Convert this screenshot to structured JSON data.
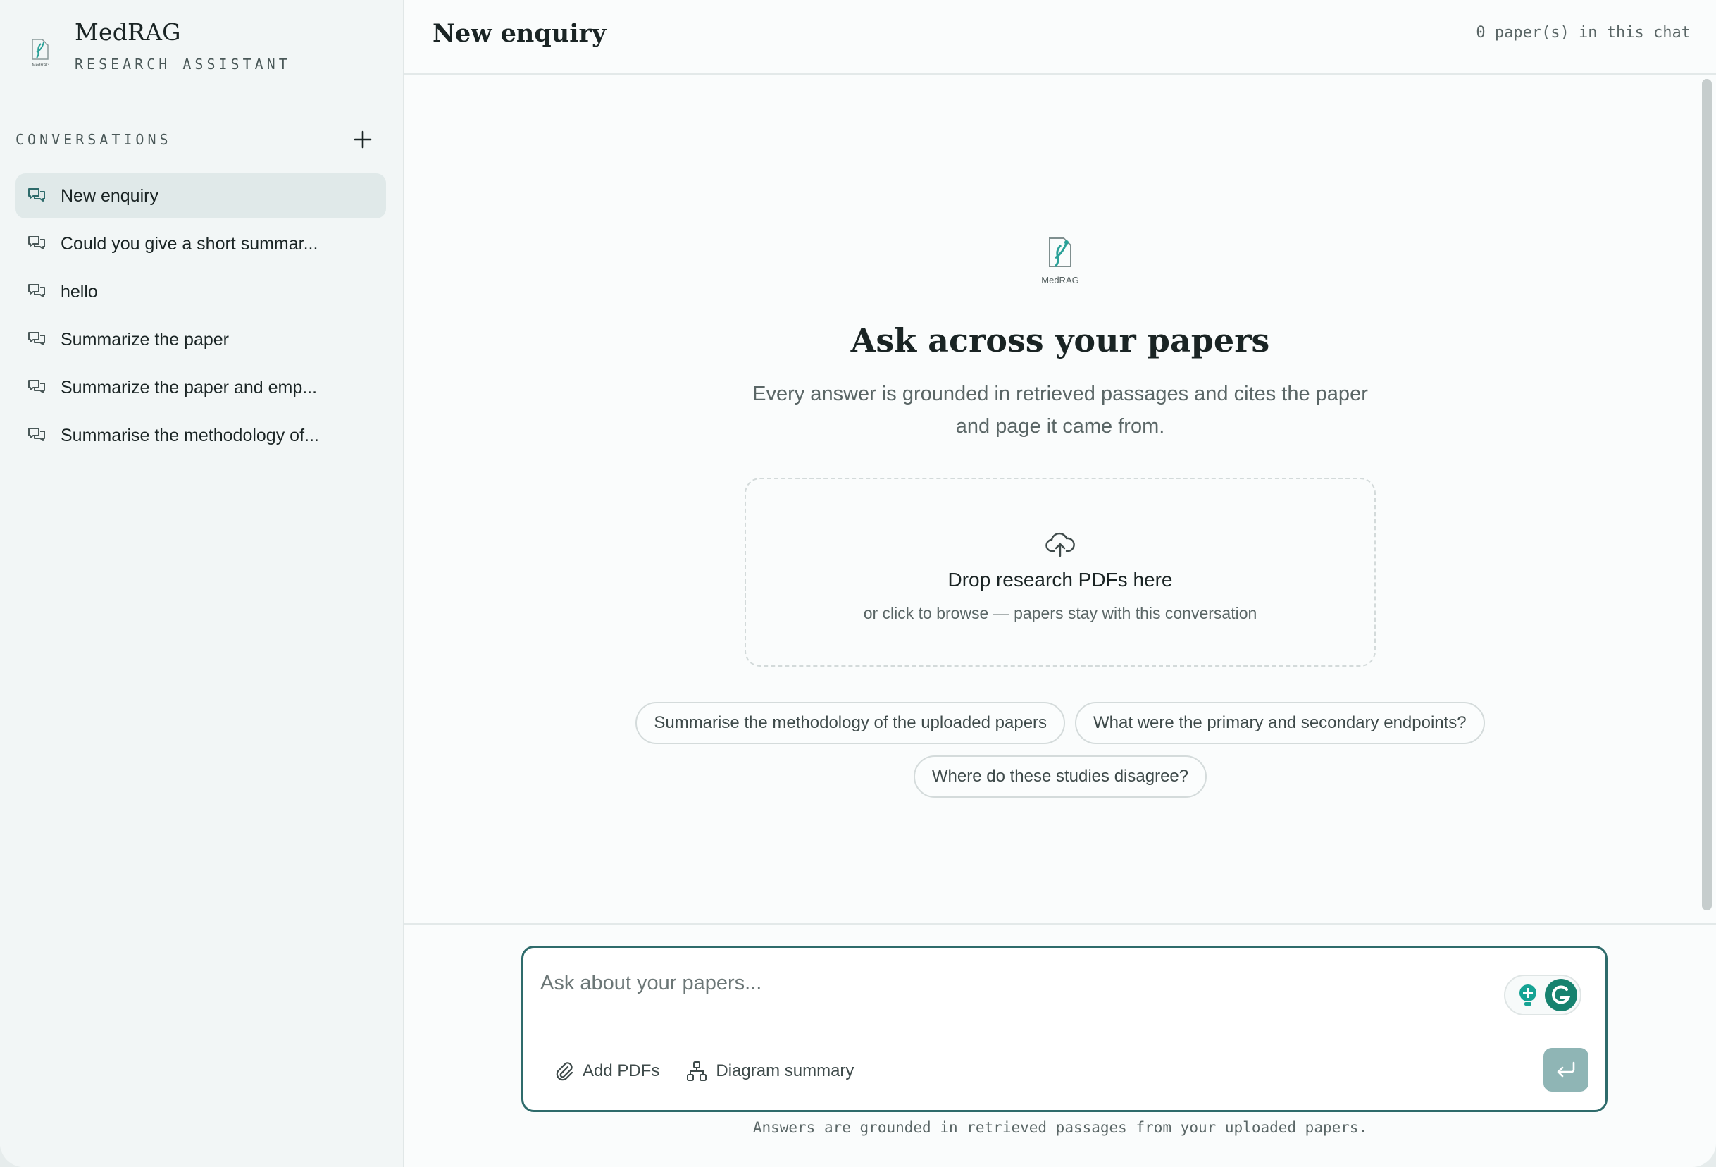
{
  "brand": {
    "title": "MedRAG",
    "subtitle": "RESEARCH ASSISTANT",
    "logo_text": "MedRAG"
  },
  "sidebar": {
    "section_title": "CONVERSATIONS",
    "items": [
      {
        "label": "New enquiry",
        "active": true
      },
      {
        "label": "Could you give a short summar..."
      },
      {
        "label": "hello"
      },
      {
        "label": "Summarize the paper"
      },
      {
        "label": "Summarize the paper and emp..."
      },
      {
        "label": "Summarise the methodology of..."
      }
    ]
  },
  "header": {
    "title": "New enquiry",
    "paper_count": "0 paper(s) in this chat"
  },
  "hero": {
    "logo_text": "MedRAG",
    "title": "Ask across your papers",
    "description": "Every answer is grounded in retrieved passages and cites the paper and page it came from."
  },
  "dropzone": {
    "title": "Drop research PDFs here",
    "subtitle": "or click to browse — papers stay with this conversation"
  },
  "suggestions": [
    "Summarise the methodology of the uploaded papers",
    "What were the primary and secondary endpoints?",
    "Where do these studies disagree?"
  ],
  "composer": {
    "placeholder": "Ask about your papers...",
    "value": "",
    "add_pdfs_label": "Add PDFs",
    "diagram_label": "Diagram summary",
    "footnote": "Answers are grounded in retrieved passages from your uploaded papers."
  },
  "colors": {
    "accent": "#2e6b6b",
    "logo_teal": "#2aa198",
    "send_button": "#8fb5b5",
    "active_item": "#e0e9e9"
  }
}
